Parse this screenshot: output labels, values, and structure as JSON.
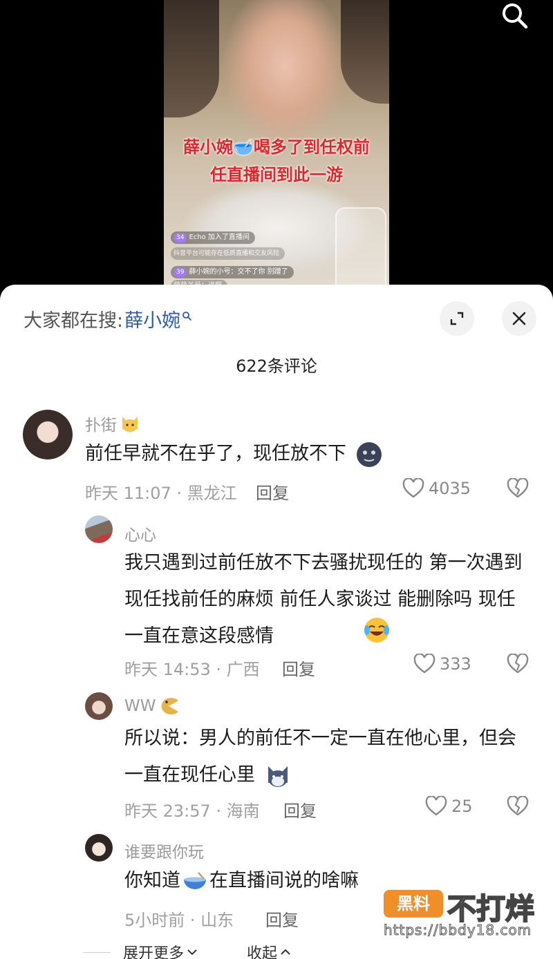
{
  "video": {
    "caption_line1": "薛小婉🥣喝多了到任权前",
    "caption_line2": "任直播间到此一游",
    "live_messages": [
      {
        "level": "34",
        "text": "Echo 加入了直播间"
      },
      {
        "level": "",
        "text": "抖音平台可能存在低质直播和交友风险"
      },
      {
        "level": "39",
        "text": "薛小婉的小号：交不了你 别蹭了"
      },
      {
        "level": "",
        "text": "薛薛关号：进啊"
      }
    ]
  },
  "search_hint": {
    "prefix": "大家都在搜:",
    "keyword": "薛小婉"
  },
  "comments_title": "622条评论",
  "comments": [
    {
      "username": "扑街",
      "text": "前任早就不在乎了，现任放不下",
      "time_location": "昨天 11:07 · 黑龙江",
      "reply_label": "回复",
      "likes": "4035"
    },
    {
      "username": "心心",
      "text": "我只遇到过前任放不下去骚扰现任的 第一次遇到现任找前任的麻烦 前任人家谈过 能删除吗 现任一直在意这段感情",
      "time_location": "昨天 14:53 · 广西",
      "reply_label": "回复",
      "likes": "333"
    },
    {
      "username": "WW",
      "text": "所以说：男人的前任不一定一直在他心里，但会一直在现任心里",
      "time_location": "昨天 23:57 · 海南",
      "reply_label": "回复",
      "likes": "25"
    },
    {
      "username": "谁要跟你玩",
      "text_part1": "你知道",
      "text_part2": "在直播间说的啥嘛",
      "time_location": "5小时前 · 山东",
      "reply_label": "回复"
    }
  ],
  "expand_more": "展开更多",
  "collapse": "收起",
  "watermark": {
    "badge": "黑料",
    "title": "不打烊",
    "url": "https://bbdy18.com"
  },
  "colors": {
    "keyword_blue": "#2e5aa6",
    "caption_red": "#e0262b",
    "watermark_orange": "#f08e2a"
  }
}
